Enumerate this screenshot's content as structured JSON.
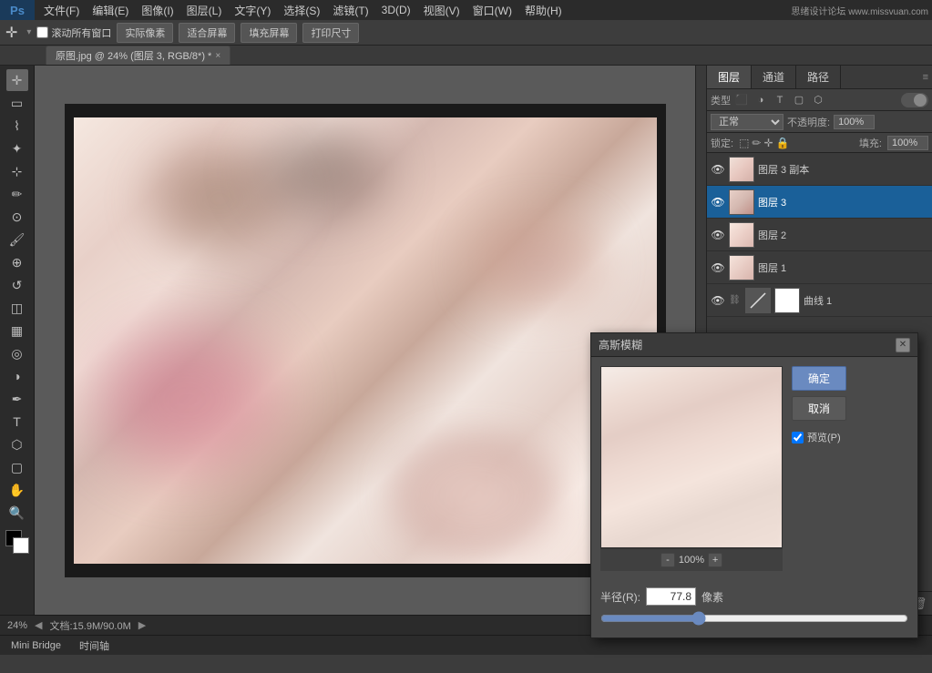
{
  "app": {
    "title": "PS",
    "logo": "Ps"
  },
  "watermark": "思绪设计论坛 www.missvuan.com",
  "menu": {
    "items": [
      "文件(F)",
      "编辑(E)",
      "图像(I)",
      "图层(L)",
      "文字(Y)",
      "选择(S)",
      "滤镜(T)",
      "3D(D)",
      "视图(V)",
      "窗口(W)",
      "帮助(H)"
    ]
  },
  "toolbar": {
    "move_label": "✛",
    "checkbox_label": "滚动所有窗口",
    "btn1": "实际像素",
    "btn2": "适合屏幕",
    "btn3": "填充屏幕",
    "btn4": "打印尺寸"
  },
  "doc_tab": {
    "label": "原图.jpg @ 24% (图层 3, RGB/8*) *",
    "close": "×"
  },
  "canvas": {
    "zoom": "24%"
  },
  "layers_panel": {
    "tabs": [
      "图层",
      "通道",
      "路径"
    ],
    "active_tab": "图层",
    "filter_label": "类型",
    "blend_mode": "正常",
    "opacity_label": "不透明度:",
    "opacity_value": "100%",
    "lock_label": "锁定:",
    "fill_label": "填充:",
    "fill_value": "100%",
    "layers": [
      {
        "name": "图层 3 副本",
        "visible": true,
        "active": false,
        "type": "normal"
      },
      {
        "name": "图层 3",
        "visible": true,
        "active": true,
        "type": "normal"
      },
      {
        "name": "图层 2",
        "visible": true,
        "active": false,
        "type": "normal"
      },
      {
        "name": "图层 1",
        "visible": true,
        "active": false,
        "type": "normal"
      },
      {
        "name": "曲线 1",
        "visible": true,
        "active": false,
        "type": "curves"
      }
    ]
  },
  "gaussian_blur": {
    "title": "高斯模糊",
    "ok_label": "确定",
    "cancel_label": "取消",
    "preview_label": "预览(P)",
    "preview_checked": true,
    "zoom_minus": "-",
    "zoom_percent": "100%",
    "zoom_plus": "+",
    "radius_label": "半径(R):",
    "radius_value": "77.8",
    "radius_unit": "像素"
  },
  "status_bar": {
    "zoom": "24%",
    "doc_label": "文档:15.9M/90.0M",
    "arrow": "▶"
  },
  "mini_bridge": {
    "tab1": "Mini Bridge",
    "tab2": "时间轴"
  }
}
